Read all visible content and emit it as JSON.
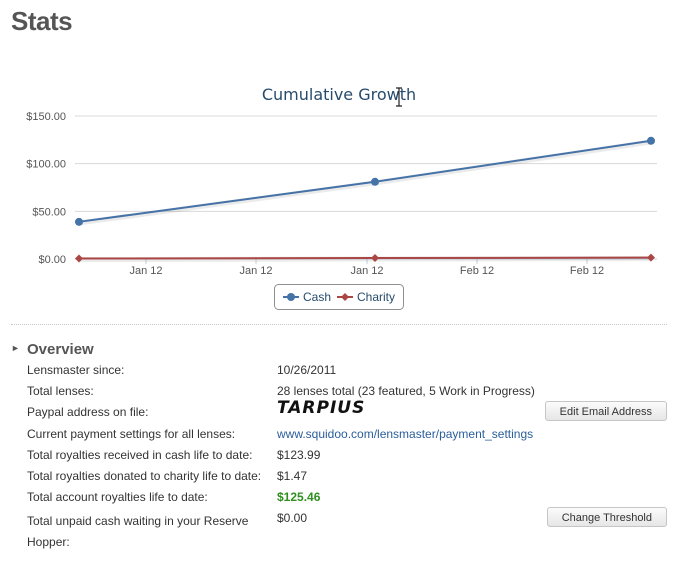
{
  "page": {
    "title": "Stats"
  },
  "chart_data": {
    "type": "line",
    "title": "Cumulative Growth",
    "x_tick_labels": [
      "Jan 12",
      "Jan 12",
      "Jan 12",
      "Feb 12",
      "Feb 12"
    ],
    "y_tick_labels": [
      "$0.00",
      "$50.00",
      "$100.00",
      "$150.00"
    ],
    "ylim": [
      0,
      150
    ],
    "grid": true,
    "legend_position": "bottom",
    "series": [
      {
        "name": "Cash",
        "color": "#4572a7",
        "values": [
          39,
          81,
          124
        ]
      },
      {
        "name": "Charity",
        "color": "#aa4643",
        "values": [
          0.5,
          1,
          1.47
        ]
      }
    ]
  },
  "overview": {
    "title": "Overview",
    "lensmaster_since_label": "Lensmaster since:",
    "lensmaster_since_value": "10/26/2011",
    "total_lenses_label": "Total lenses:",
    "total_lenses_value": "28 lenses total (23 featured, 5 Work in Progress)",
    "paypal_label": "Paypal address on file:",
    "paypal_value": "TARPIUS",
    "edit_email_button": "Edit Email Address",
    "payment_settings_label": "Current payment settings for all lenses:",
    "payment_settings_link": "www.squidoo.com/lensmaster/payment_settings",
    "cash_royalties_label": "Total royalties received in cash life to date:",
    "cash_royalties_value": "$123.99",
    "charity_royalties_label": "Total royalties donated to charity life to date:",
    "charity_royalties_value": "$1.47",
    "account_royalties_label": "Total account royalties life to date:",
    "account_royalties_value": "$125.46",
    "unpaid_cash_label": "Total unpaid cash waiting in your Reserve Hopper:",
    "unpaid_cash_value": "$0.00",
    "change_threshold_button": "Change Threshold"
  }
}
